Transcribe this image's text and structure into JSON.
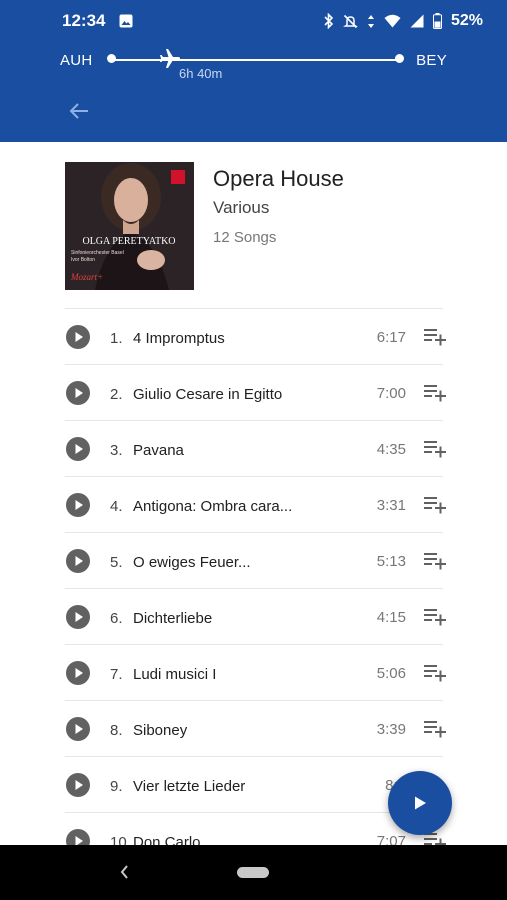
{
  "status_bar": {
    "time": "12:34",
    "battery": "52%",
    "icons": [
      "image-icon",
      "bluetooth-icon",
      "do-not-disturb-icon",
      "data-arrows-icon",
      "wifi-icon",
      "signal-icon",
      "battery-icon"
    ]
  },
  "flight": {
    "origin": "AUH",
    "destination": "BEY",
    "duration": "6h 40m",
    "icons": [
      "plane-icon",
      "back-arrow-icon"
    ]
  },
  "album": {
    "title": "Opera House",
    "artist": "Various",
    "song_count": "12 Songs",
    "cover_text": {
      "artist_name": "OLGA PERETYATKO",
      "subtitle_1": "Sinfonieorchester Basel",
      "subtitle_2": "Ivor Bolton",
      "series": "Mozart+"
    }
  },
  "tracks": [
    {
      "number": "1.",
      "title": "4 Impromptus",
      "duration": "6:17"
    },
    {
      "number": "2.",
      "title": "Giulio Cesare in Egitto",
      "duration": "7:00"
    },
    {
      "number": "3.",
      "title": "Pavana",
      "duration": "4:35"
    },
    {
      "number": "4.",
      "title": "Antigona: Ombra cara...",
      "duration": "3:31"
    },
    {
      "number": "5.",
      "title": "O ewiges Feuer...",
      "duration": "5:13"
    },
    {
      "number": "6.",
      "title": "Dichterliebe",
      "duration": "4:15"
    },
    {
      "number": "7.",
      "title": "Ludi musici I",
      "duration": "5:06"
    },
    {
      "number": "8.",
      "title": "Siboney",
      "duration": "3:39"
    },
    {
      "number": "9.",
      "title": "Vier letzte Lieder",
      "duration": "8:5"
    },
    {
      "number": "10.",
      "title": "Don Carlo",
      "duration": "7:07"
    }
  ],
  "colors": {
    "brand_blue": "#1a4ea1",
    "icon_gray": "#616161"
  }
}
